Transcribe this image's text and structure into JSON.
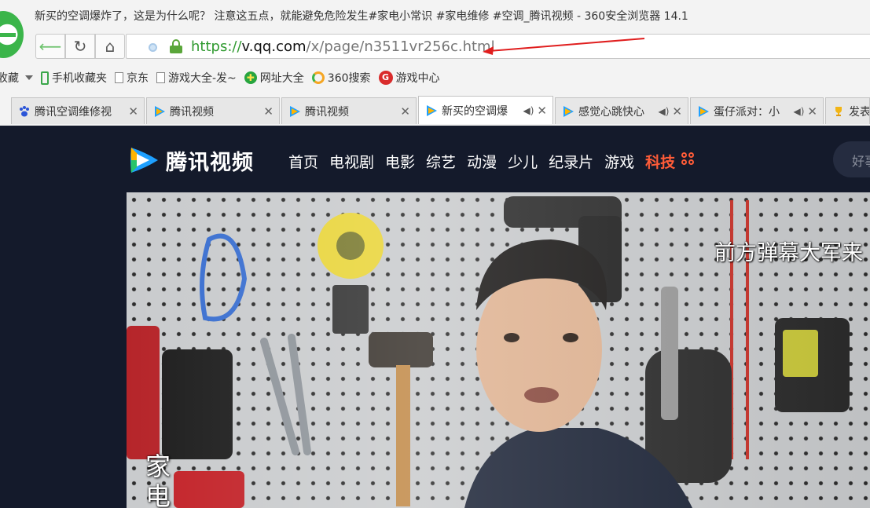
{
  "window": {
    "title": "新买的空调爆炸了，这是为什么呢？ 注意这五点，就能避免危险发生#家电小常识 #家电维修 #空调_腾讯视频 - 360安全浏览器 14.1"
  },
  "address_bar": {
    "url_scheme": "https://",
    "url_host": "v.qq.com",
    "url_path": "/x/page/n3511vr256c.html"
  },
  "bookmarks": [
    {
      "label": "收藏",
      "icon": "star-icon"
    },
    {
      "label": "手机收藏夹",
      "icon": "phone-icon"
    },
    {
      "label": "京东",
      "icon": "page-icon"
    },
    {
      "label": "游戏大全-发~",
      "icon": "page-icon"
    },
    {
      "label": "网址大全",
      "icon": "green-ball-icon"
    },
    {
      "label": "360搜索",
      "icon": "search-ring-icon"
    },
    {
      "label": "游戏中心",
      "icon": "game-icon"
    }
  ],
  "tabs": [
    {
      "title": "腾讯空调维修视",
      "icon": "baidu-paw-icon",
      "active": false,
      "sound": false
    },
    {
      "title": "腾讯视频",
      "icon": "tencent-video-icon",
      "active": false,
      "sound": false
    },
    {
      "title": "腾讯视频",
      "icon": "tencent-video-icon",
      "active": false,
      "sound": false
    },
    {
      "title": "新买的空调爆",
      "icon": "tencent-video-icon",
      "active": true,
      "sound": true
    },
    {
      "title": "感觉心跳快心",
      "icon": "tencent-video-icon",
      "active": false,
      "sound": true
    },
    {
      "title": "蛋仔派对：小",
      "icon": "tencent-video-icon",
      "active": false,
      "sound": true
    },
    {
      "title": "发表",
      "icon": "trophy-icon",
      "active": false,
      "sound": false
    }
  ],
  "site": {
    "name": "腾讯视频",
    "nav": [
      "首页",
      "电视剧",
      "电影",
      "综艺",
      "动漫",
      "少儿",
      "纪录片",
      "游戏"
    ],
    "nav_hot": "科技",
    "search_placeholder": "好事",
    "accent_color": "#ff5c38"
  },
  "video": {
    "danmu": "前方弹幕大军来",
    "subtitle": "家电"
  }
}
